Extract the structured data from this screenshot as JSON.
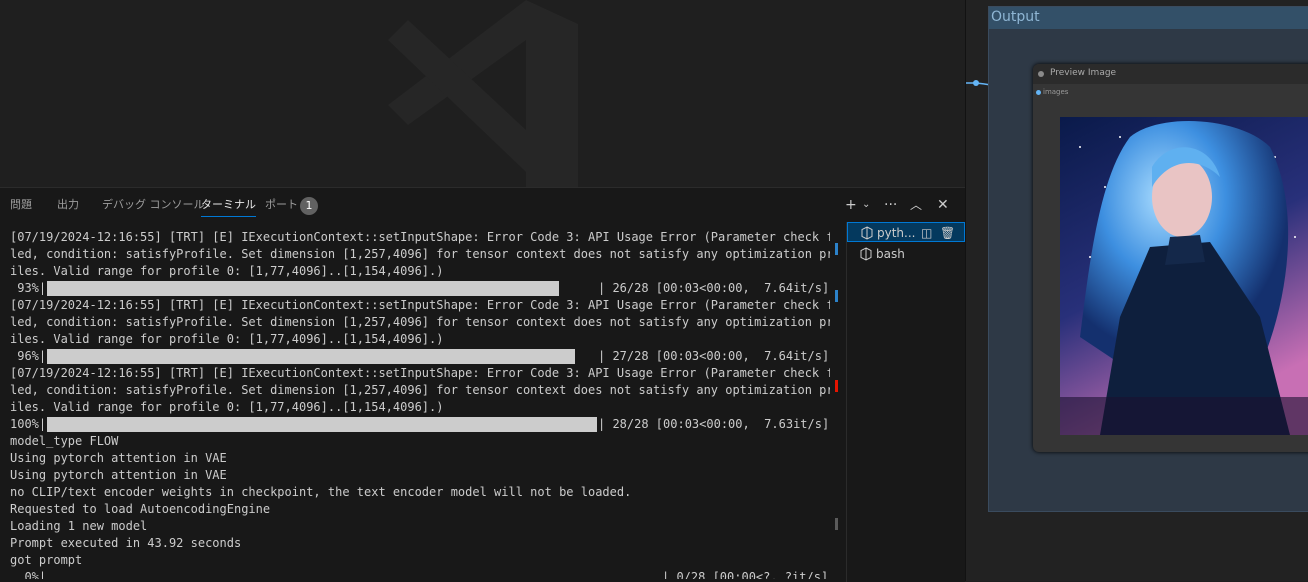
{
  "panel": {
    "tabs": [
      {
        "label": "問題",
        "active": false
      },
      {
        "label": "出力",
        "active": false
      },
      {
        "label": "デバッグ コンソール",
        "active": false
      },
      {
        "label": "ターミナル",
        "active": true
      },
      {
        "label": "ポート",
        "active": false
      }
    ],
    "ports_badge": "1",
    "actions": {
      "add_icon": "plus-icon",
      "dropdown_icon": "chevron-down-icon",
      "more_icon": "ellipsis-icon",
      "maximize_icon": "chevron-up-icon",
      "close_icon": "close-icon"
    }
  },
  "terminal": {
    "lines": [
      "[07/19/2024-12:16:55] [TRT] [E] IExecutionContext::setInputShape: Error Code 3: API Usage Error (Parameter check fai",
      "led, condition: satisfyProfile. Set dimension [1,257,4096] for tensor context does not satisfy any optimization prof",
      "iles. Valid range for profile 0: [1,77,4096]..[1,154,4096].)",
      "[07/19/2024-12:16:55] [TRT] [E] IExecutionContext::setInputShape: Error Code 3: API Usage Error (Parameter check fai",
      "led, condition: satisfyProfile. Set dimension [1,257,4096] for tensor context does not satisfy any optimization prof",
      "iles. Valid range for profile 0: [1,77,4096]..[1,154,4096].)",
      "[07/19/2024-12:16:55] [TRT] [E] IExecutionContext::setInputShape: Error Code 3: API Usage Error (Parameter check fai",
      "led, condition: satisfyProfile. Set dimension [1,257,4096] for tensor context does not satisfy any optimization prof",
      "iles. Valid range for profile 0: [1,77,4096]..[1,154,4096].)",
      "model_type FLOW",
      "Using pytorch attention in VAE",
      "Using pytorch attention in VAE",
      "no CLIP/text encoder weights in checkpoint, the text encoder model will not be loaded.",
      "Requested to load AutoencodingEngine",
      "Loading 1 new model",
      "Prompt executed in 43.92 seconds",
      "got prompt"
    ],
    "progress": [
      {
        "pct": " 93%|",
        "fraction": 0.93,
        "stat": "| 26/28 [00:03<00:00,  7.64it/s]"
      },
      {
        "pct": " 96%|",
        "fraction": 0.96,
        "stat": "| 27/28 [00:03<00:00,  7.64it/s]"
      },
      {
        "pct": "100%|",
        "fraction": 1.0,
        "stat": "| 28/28 [00:03<00:00,  7.63it/s]"
      },
      {
        "pct": "  0%|",
        "fraction": 0.0,
        "stat": "| 0/28 [00:00<?, ?it/s]"
      }
    ],
    "highlight_color": "#e51400"
  },
  "terminal_list": [
    {
      "label": "pyth...",
      "icon": "terminal-python-icon",
      "selected": true,
      "split_icon": "split-icon",
      "delete_icon": "trash-icon"
    },
    {
      "label": "bash",
      "icon": "terminal-bash-icon",
      "selected": false
    }
  ],
  "comfy": {
    "group_title": "Output",
    "node_title": "Preview Image",
    "input_label": "images",
    "accent": "#64b5f6"
  }
}
